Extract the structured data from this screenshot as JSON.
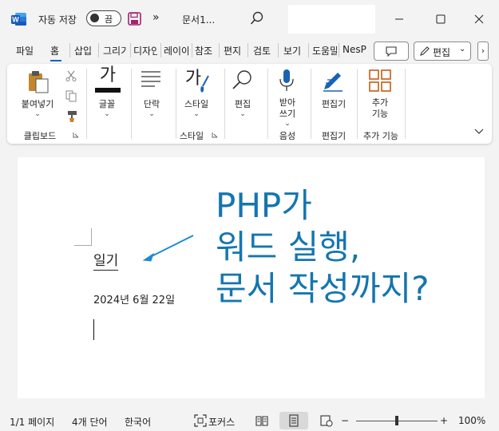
{
  "titlebar": {
    "autosave_label": "자동 저장",
    "autosave_state": "끔",
    "more": "»",
    "doc_title": "문서1..."
  },
  "tabs": [
    "파일",
    "홈",
    "삽입",
    "그리기",
    "디자인",
    "레이아웃",
    "참조",
    "편지",
    "검토",
    "보기",
    "도움말",
    "NesPDF"
  ],
  "active_tab": "홈",
  "edit_button": "편집",
  "ribbon": {
    "paste": "붙여넣기",
    "font": "글꼴",
    "paragraph": "단락",
    "styles": "스타일",
    "editing": "편집",
    "dictate": "받아\n쓰기",
    "dictate_line1": "받아",
    "dictate_line2": "쓰기",
    "editor": "편집기",
    "addins": "추가\n기능",
    "addins_line1": "추가",
    "addins_line2": "기능",
    "groups": {
      "clipboard": "클립보드",
      "styles": "스타일",
      "voice": "음성",
      "editor": "편집기",
      "addins": "추가 기능"
    },
    "font_glyph": "가",
    "styles_glyph": "가"
  },
  "document": {
    "heading": "일기",
    "date": "2024년 6월 22일"
  },
  "overlay": {
    "line1": "PHP가",
    "line2": "워드 실행,",
    "line3": "문서 작성까지?",
    "color": "#1476ae"
  },
  "statusbar": {
    "page": "1/1 페이지",
    "words": "4개 단어",
    "language": "한국어",
    "focus": "포커스",
    "zoom_out": "−",
    "zoom_in": "+",
    "zoom": "100%"
  },
  "colors": {
    "word_blue": "#185abd",
    "accent": "#1a62b4",
    "save_icon": "#a3226b",
    "addins_orange": "#c75b12"
  }
}
